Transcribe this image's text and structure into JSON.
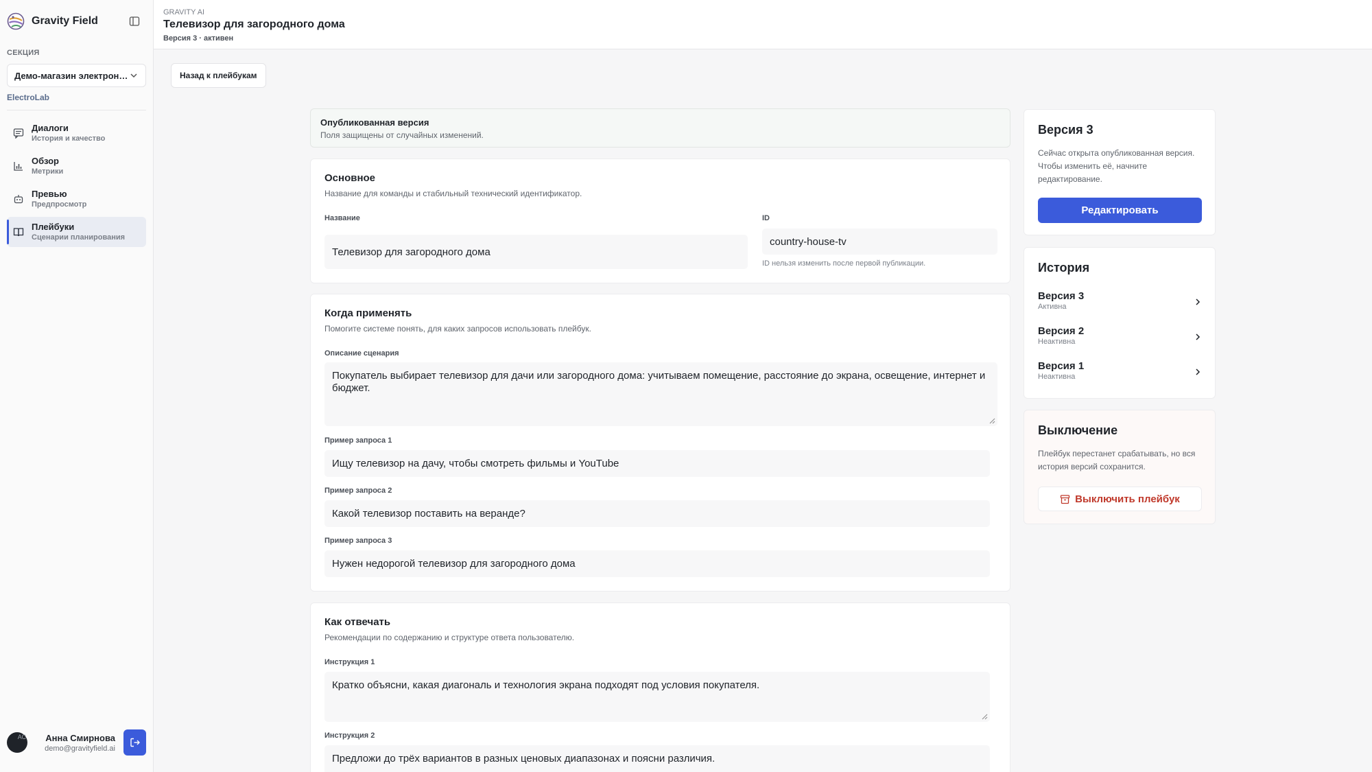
{
  "sidebar": {
    "brand": "Gravity Field",
    "section_label": "СЕКЦИЯ",
    "section_value": "Демо-магазин электроники",
    "org": "ElectroLab",
    "items": [
      {
        "title": "Диалоги",
        "sub": "История и качество",
        "icon": "chat-icon",
        "active": false
      },
      {
        "title": "Обзор",
        "sub": "Метрики",
        "icon": "bar-chart-icon",
        "active": false
      },
      {
        "title": "Превью",
        "sub": "Предпросмотр",
        "icon": "robot-icon",
        "active": false
      },
      {
        "title": "Плейбуки",
        "sub": "Сценарии планирования",
        "icon": "book-icon",
        "active": true
      }
    ],
    "user": {
      "initials": "АС",
      "name": "Анна Смирнова",
      "email": "demo@gravityfield.ai"
    }
  },
  "header": {
    "crumb": "GRAVITY AI",
    "title": "Телевизор для загородного дома",
    "sub": "Версия 3 · активен"
  },
  "back_button": "Назад к плейбукам",
  "notice": {
    "title": "Опубликованная версия",
    "sub": "Поля защищены от случайных изменений."
  },
  "basic": {
    "title": "Основное",
    "desc": "Название для команды и стабильный технический идентификатор.",
    "name_label": "Название",
    "name_value": "Телевизор для загородного дома",
    "id_label": "ID",
    "id_value": "country-house-tv",
    "id_hint": "ID нельзя изменить после первой публикации."
  },
  "when": {
    "title": "Когда применять",
    "desc": "Помогите системе понять, для каких запросов использовать плейбук.",
    "scenario_label": "Описание сценария",
    "scenario_value": "Покупатель выбирает телевизор для дачи или загородного дома: учитываем помещение, расстояние до экрана, освещение, интернет и бюджет.",
    "examples": [
      {
        "label": "Пример запроса 1",
        "value": "Ищу телевизор на дачу, чтобы смотреть фильмы и YouTube"
      },
      {
        "label": "Пример запроса 2",
        "value": "Какой телевизор поставить на веранде?"
      },
      {
        "label": "Пример запроса 3",
        "value": "Нужен недорогой телевизор для загородного дома"
      }
    ]
  },
  "how": {
    "title": "Как отвечать",
    "desc": "Рекомендации по содержанию и структуре ответа пользователю.",
    "instructions": [
      {
        "label": "Инструкция 1",
        "value": "Кратко объясни, какая диагональ и технология экрана подходят под условия покупателя."
      },
      {
        "label": "Инструкция 2",
        "value": "Предложи до трёх вариантов в разных ценовых диапазонах и поясни различия."
      }
    ]
  },
  "version_card": {
    "title": "Версия 3",
    "desc": "Сейчас открыта опубликованная версия. Чтобы изменить её, начните редактирование.",
    "button": "Редактировать"
  },
  "history": {
    "title": "История",
    "items": [
      {
        "name": "Версия 3",
        "status": "Активна"
      },
      {
        "name": "Версия 2",
        "status": "Неактивна"
      },
      {
        "name": "Версия 1",
        "status": "Неактивна"
      }
    ]
  },
  "disable_card": {
    "title": "Выключение",
    "desc": "Плейбук перестанет срабатывать, но вся история версий сохранится.",
    "button": "Выключить плейбук"
  },
  "colors": {
    "accent": "#3b5bdb",
    "danger": "#c0392b"
  }
}
